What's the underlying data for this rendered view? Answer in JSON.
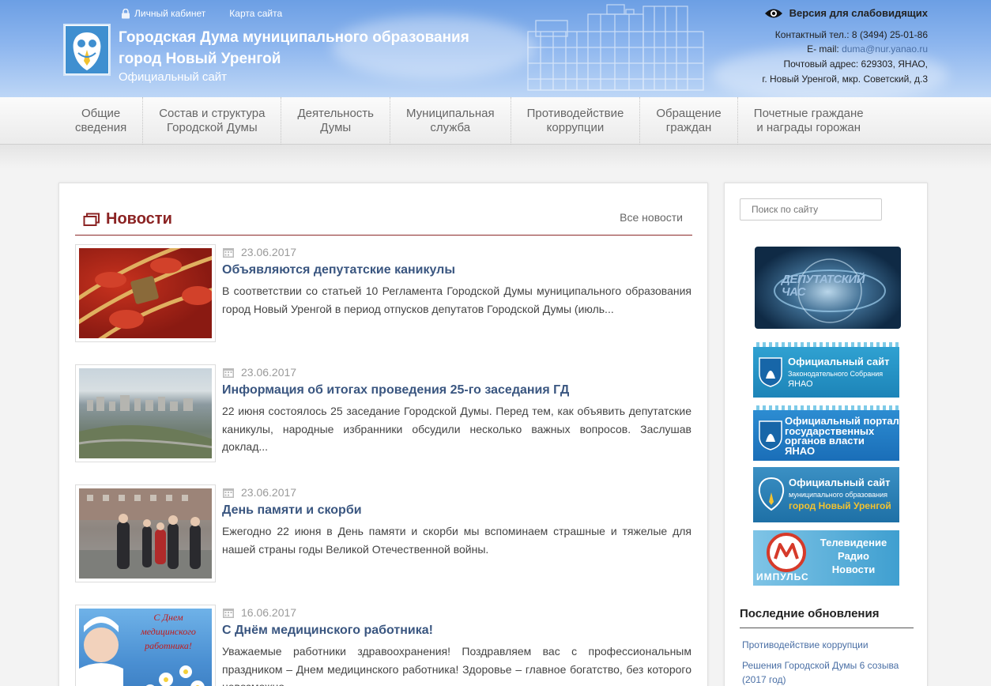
{
  "header": {
    "personal_cabinet": "Личный кабинет",
    "site_map": "Карта сайта",
    "title_line1": "Городская Дума муниципального образования",
    "title_line2": "город Новый Уренгой",
    "subtitle": "Официальный сайт",
    "visually_impaired": "Версия для слабовидящих",
    "phone": "Контактный тел.: 8 (3494) 25-01-86",
    "email_label": "E- mail:",
    "email": "duma@nur.yanao.ru",
    "address_line1": "Почтовый адрес: 629303, ЯНАО,",
    "address_line2": "г. Новый Уренгой, мкр. Советский, д.3"
  },
  "nav": [
    "Общие\nсведения",
    "Состав и структура\nГородской Думы",
    "Деятельность\nДумы",
    "Муниципальная\nслужба",
    "Противодействие\nкоррупции",
    "Обращение\nграждан",
    "Почетные граждане\nи награды горожан"
  ],
  "news": {
    "heading": "Новости",
    "all_link": "Все новости",
    "items": [
      {
        "date": "23.06.2017",
        "title": "Объявляются депутатские каникулы",
        "text": "В соответствии со статьей 10 Регламента Городской Думы муниципального образования город Новый Уренгой в период отпусков депутатов Городской Думы (июль..."
      },
      {
        "date": "23.06.2017",
        "title": "Информация об итогах проведения 25-го заседания ГД",
        "text": "22 июня состоялось 25 заседание Городской Думы. Перед тем, как объявить депутатские каникулы, народные избранники обсудили несколько важных вопросов. Заслушав доклад..."
      },
      {
        "date": "23.06.2017",
        "title": "День памяти и скорби",
        "text": "Ежегодно 22 июня в День памяти и скорби мы вспоминаем страшные и тяжелые для нашей страны годы Великой Отечественной войны."
      },
      {
        "date": "16.06.2017",
        "title": "С Днём медицинского работника!",
        "text": "Уважаемые работники здравоохранения! Поздравляем вас с профессиональным праздником – Днем медицинского работника! Здоровье – главное богатство, без которого невозможно..."
      }
    ],
    "card_caption": "С Днем медицинского работника!"
  },
  "sidebar": {
    "search_placeholder": "Поиск по сайту",
    "banner_video": "Депутатский час",
    "banner1_title": "Официальный сайт",
    "banner1_sub": "Законодательного Собрания",
    "banner1_region": "ЯНАО",
    "banner2_title": "Официальный портал",
    "banner2_line2": "государственных",
    "banner2_line3": "органов власти",
    "banner2_region": "ЯНАО",
    "banner3_title": "Официальный сайт",
    "banner3_sub": "муниципального образования",
    "banner3_city": "город Новый Уренгой",
    "banner4_line1": "Телевидение",
    "banner4_line2": "Радио",
    "banner4_line3": "Новости",
    "banner4_brand": "ИМПУЛЬС",
    "updates_title": "Последние обновления",
    "updates": [
      "Противодействие коррупции",
      "Решения Городской Думы 6 созыва (2017 год)"
    ]
  },
  "colors": {
    "header_blue": "#6c9fe4",
    "news_accent": "#8b2323",
    "link_blue": "#3a5680",
    "banner_teal": "#1d7fb0"
  }
}
